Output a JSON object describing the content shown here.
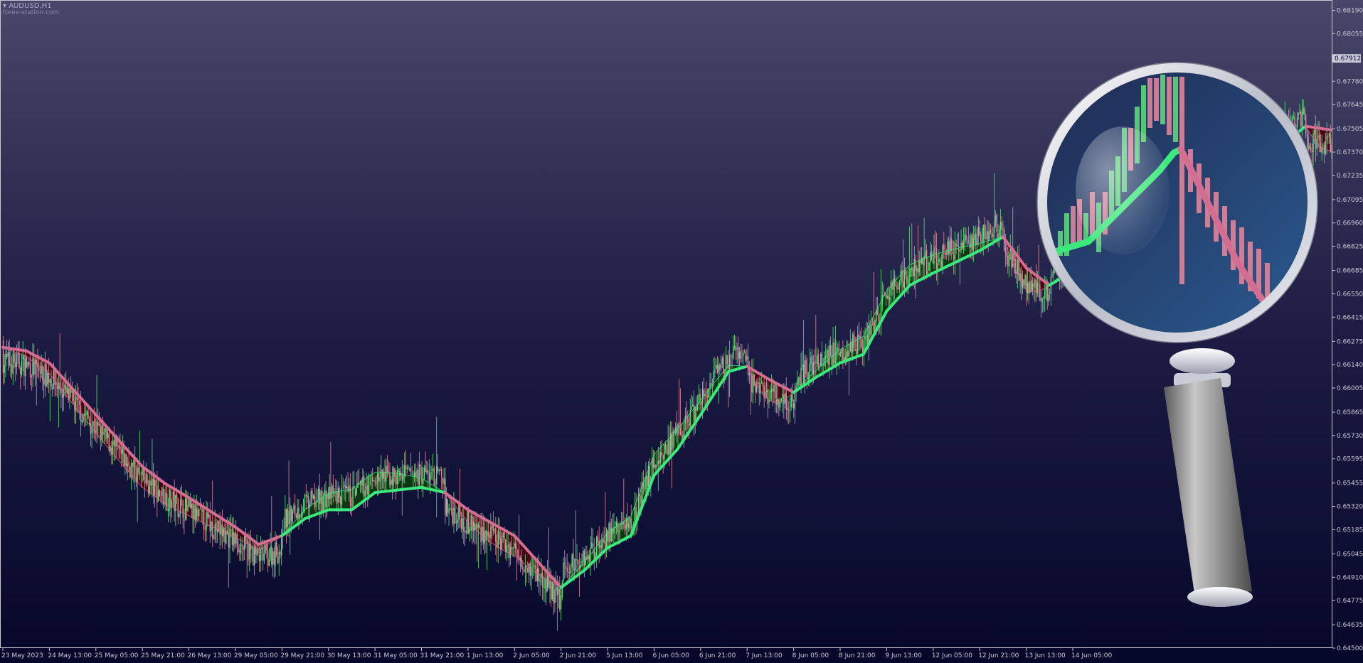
{
  "header": {
    "symbol": "AUDUSD,H1",
    "watermark": "forex-station.com"
  },
  "colors": {
    "bg_top": "#474769",
    "bg_bottom": "#05072a",
    "bull_candle": "#5ee07a",
    "bear_candle": "#e58aa0",
    "bull_ma": "#3be87c",
    "bear_ma": "#d36d91",
    "bull_fill": "#0e3b12",
    "bear_fill": "#4a0612",
    "axis_text": "#c8c8d8",
    "current_price_bg": "#c8c8d8"
  },
  "chart_data": {
    "type": "candlestick",
    "symbol": "AUDUSD",
    "timeframe": "H1",
    "current_price": "0.67912",
    "ylim": [
      0.645,
      0.6825
    ],
    "y_ticks": [
      "0.68190",
      "0.68055",
      "0.67780",
      "0.67645",
      "0.67505",
      "0.67370",
      "0.67235",
      "0.67095",
      "0.66960",
      "0.66825",
      "0.66685",
      "0.66550",
      "0.66415",
      "0.66275",
      "0.66140",
      "0.66005",
      "0.65865",
      "0.65730",
      "0.65595",
      "0.65455",
      "0.65320",
      "0.65185",
      "0.65045",
      "0.64910",
      "0.64775",
      "0.64635",
      "0.64500"
    ],
    "x_ticks": [
      "23 May 2023",
      "24 May 13:00",
      "25 May 05:00",
      "25 May 21:00",
      "26 May 13:00",
      "29 May 05:00",
      "29 May 21:00",
      "30 May 13:00",
      "31 May 05:00",
      "31 May 21:00",
      "1 Jun 13:00",
      "2 Jun 05:00",
      "2 Jun 21:00",
      "5 Jun 13:00",
      "6 Jun 05:00",
      "6 Jun 21:00",
      "7 Jun 13:00",
      "8 Jun 05:00",
      "8 Jun 21:00",
      "9 Jun 13:00",
      "12 Jun 05:00",
      "12 Jun 21:00",
      "13 Jun 13:00",
      "14 Jun 05:00"
    ],
    "ma_path": [
      {
        "x": 0,
        "y": 0.6624
      },
      {
        "x": 0.5,
        "y": 0.6622
      },
      {
        "x": 1,
        "y": 0.6615
      },
      {
        "x": 2,
        "y": 0.6585
      },
      {
        "x": 3,
        "y": 0.6555
      },
      {
        "x": 3.5,
        "y": 0.6545
      },
      {
        "x": 4,
        "y": 0.6537
      },
      {
        "x": 5,
        "y": 0.652
      },
      {
        "x": 5.5,
        "y": 0.651
      },
      {
        "x": 6,
        "y": 0.6515
      },
      {
        "x": 6.5,
        "y": 0.6525
      },
      {
        "x": 7,
        "y": 0.653
      },
      {
        "x": 7.5,
        "y": 0.653
      },
      {
        "x": 8,
        "y": 0.654
      },
      {
        "x": 9,
        "y": 0.6543
      },
      {
        "x": 9.5,
        "y": 0.654
      },
      {
        "x": 10,
        "y": 0.653
      },
      {
        "x": 11,
        "y": 0.6515
      },
      {
        "x": 11.5,
        "y": 0.65
      },
      {
        "x": 12,
        "y": 0.6485
      },
      {
        "x": 12.5,
        "y": 0.6495
      },
      {
        "x": 13,
        "y": 0.6508
      },
      {
        "x": 13.5,
        "y": 0.6515
      },
      {
        "x": 14,
        "y": 0.655
      },
      {
        "x": 14.5,
        "y": 0.6565
      },
      {
        "x": 15,
        "y": 0.6585
      },
      {
        "x": 15.6,
        "y": 0.661
      },
      {
        "x": 16,
        "y": 0.6613
      },
      {
        "x": 16.5,
        "y": 0.6605
      },
      {
        "x": 17,
        "y": 0.6598
      },
      {
        "x": 17.5,
        "y": 0.6607
      },
      {
        "x": 18,
        "y": 0.6615
      },
      {
        "x": 18.5,
        "y": 0.662
      },
      {
        "x": 19,
        "y": 0.6645
      },
      {
        "x": 19.5,
        "y": 0.666
      },
      {
        "x": 20,
        "y": 0.6667
      },
      {
        "x": 21,
        "y": 0.668
      },
      {
        "x": 21.5,
        "y": 0.6688
      },
      {
        "x": 22,
        "y": 0.667
      },
      {
        "x": 22.5,
        "y": 0.666
      },
      {
        "x": 23,
        "y": 0.6668
      },
      {
        "x": 23.5,
        "y": 0.6683
      },
      {
        "x": 24,
        "y": 0.6698
      },
      {
        "x": 25,
        "y": 0.6704
      },
      {
        "x": 25.5,
        "y": 0.67
      },
      {
        "x": 26,
        "y": 0.6709
      },
      {
        "x": 26.5,
        "y": 0.6725
      },
      {
        "x": 27,
        "y": 0.6737
      },
      {
        "x": 27.5,
        "y": 0.674
      },
      {
        "x": 28,
        "y": 0.6752
      },
      {
        "x": 28.5,
        "y": 0.675
      },
      {
        "x": 29,
        "y": 0.6748
      },
      {
        "x": 29.5,
        "y": 0.6758
      },
      {
        "x": 30,
        "y": 0.677
      },
      {
        "x": 30.5,
        "y": 0.6775
      },
      {
        "x": 31,
        "y": 0.6769
      },
      {
        "x": 31.5,
        "y": 0.677
      },
      {
        "x": 32,
        "y": 0.6778
      }
    ],
    "ma_segments": [
      {
        "from": 0,
        "to": 6,
        "trend": "bear"
      },
      {
        "from": 6,
        "to": 9.5,
        "trend": "bull"
      },
      {
        "from": 9.5,
        "to": 12,
        "trend": "bear"
      },
      {
        "from": 12,
        "to": 16,
        "trend": "bull"
      },
      {
        "from": 16,
        "to": 17,
        "trend": "bear"
      },
      {
        "from": 17,
        "to": 21.5,
        "trend": "bull"
      },
      {
        "from": 21.5,
        "to": 22.5,
        "trend": "bear"
      },
      {
        "from": 22.5,
        "to": 28,
        "trend": "bull"
      },
      {
        "from": 28,
        "to": 29,
        "trend": "bear"
      },
      {
        "from": 29,
        "to": 30.5,
        "trend": "bull"
      },
      {
        "from": 30.5,
        "to": 31,
        "trend": "bear"
      },
      {
        "from": 31,
        "to": 32,
        "trend": "bull"
      }
    ]
  }
}
